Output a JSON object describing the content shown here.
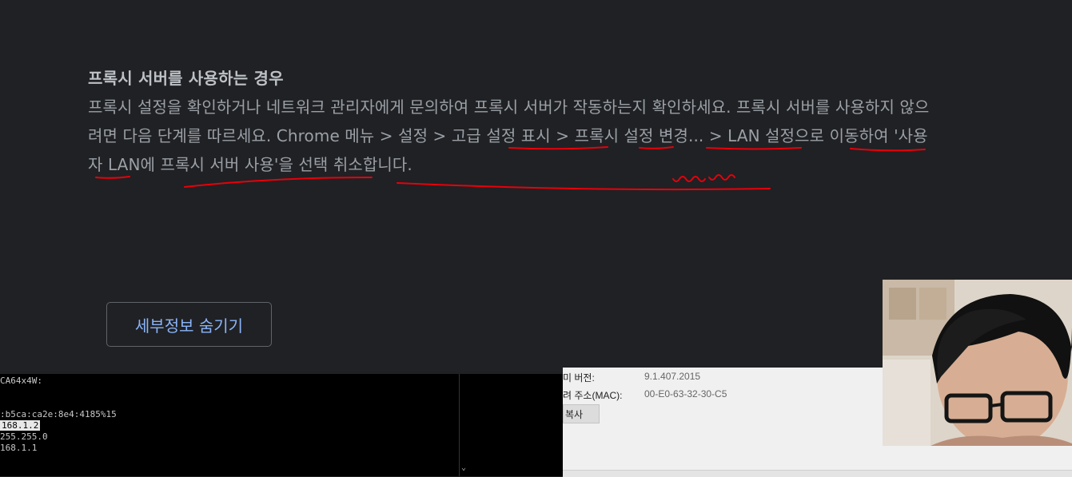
{
  "error_page": {
    "heading": "프록시 서버를 사용하는 경우",
    "body_segments": [
      "프록시 설정을 확인하거나 네트워크 관리자에게 문의하여 프록시 서버가 작동하는지 확인하세요. 프록시 서버를 사용하지 않으려면 다음 단계를 따르세요. ",
      "Chrome 메뉴",
      " > ",
      "설정",
      " > ",
      "고급 설정 표시",
      " > ",
      "프록시 설정 변경...",
      " > ",
      "LAN 설정으로 이동하여 '사용자 LAN에 프록시 서버 사용'을 선택 취소합니다."
    ],
    "hide_details_button": "세부정보 숨기기",
    "annotation_color": "#e8000b"
  },
  "console": {
    "lines": [
      "CA64x4W:",
      ":b5ca:ca2e:8e4:4185%15",
      "168.1.2",
      "255.255.0",
      "168.1.1"
    ],
    "scroll_arrow": "⌄"
  },
  "network_details": {
    "row1_label": "미 버전:",
    "row1_value": "9.1.407.2015",
    "row2_label": "려 주소(MAC):",
    "row2_value": "00-E0-63-32-30-C5",
    "copy_button": "복사"
  }
}
